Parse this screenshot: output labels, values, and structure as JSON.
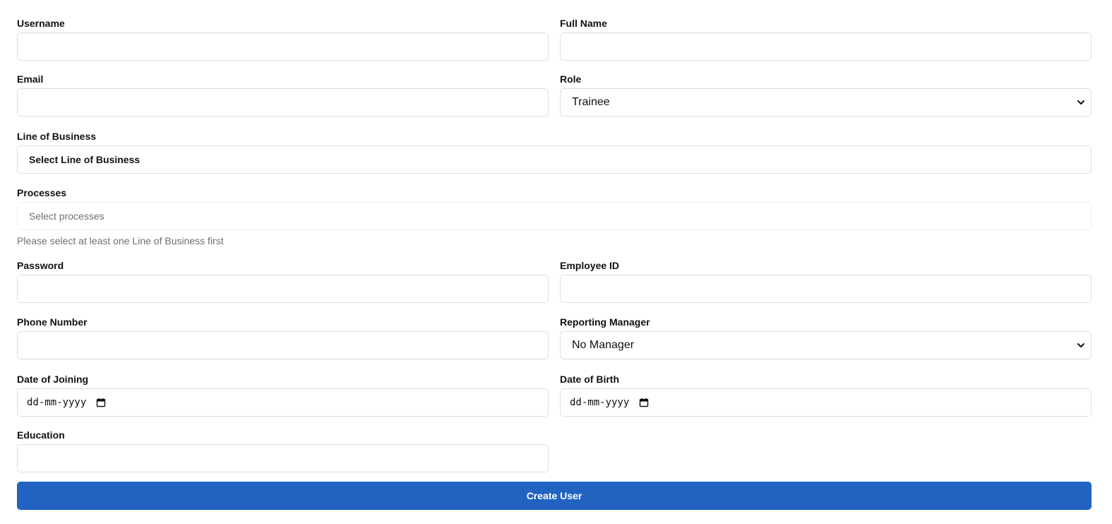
{
  "form": {
    "username": {
      "label": "Username",
      "value": ""
    },
    "full_name": {
      "label": "Full Name",
      "value": ""
    },
    "email": {
      "label": "Email",
      "value": ""
    },
    "role": {
      "label": "Role",
      "selected": "Trainee"
    },
    "line_of_business": {
      "label": "Line of Business",
      "selected": "Select Line of Business"
    },
    "processes": {
      "label": "Processes",
      "placeholder": "Select processes",
      "hint": "Please select at least one Line of Business first"
    },
    "password": {
      "label": "Password",
      "value": ""
    },
    "employee_id": {
      "label": "Employee ID",
      "value": ""
    },
    "phone_number": {
      "label": "Phone Number",
      "value": ""
    },
    "reporting_manager": {
      "label": "Reporting Manager",
      "selected": "No Manager"
    },
    "date_of_joining": {
      "label": "Date of Joining",
      "placeholder": "dd-mm-yyyy"
    },
    "date_of_birth": {
      "label": "Date of Birth",
      "placeholder": "dd-mm-yyyy"
    },
    "education": {
      "label": "Education",
      "value": ""
    },
    "submit_label": "Create User"
  },
  "icons": {
    "select_arrow": "chevron-down-icon",
    "date_picker": "calendar-icon"
  },
  "colors": {
    "primary": "#2263c2",
    "border": "#dcdfe4",
    "muted_text": "#6b6f76"
  }
}
